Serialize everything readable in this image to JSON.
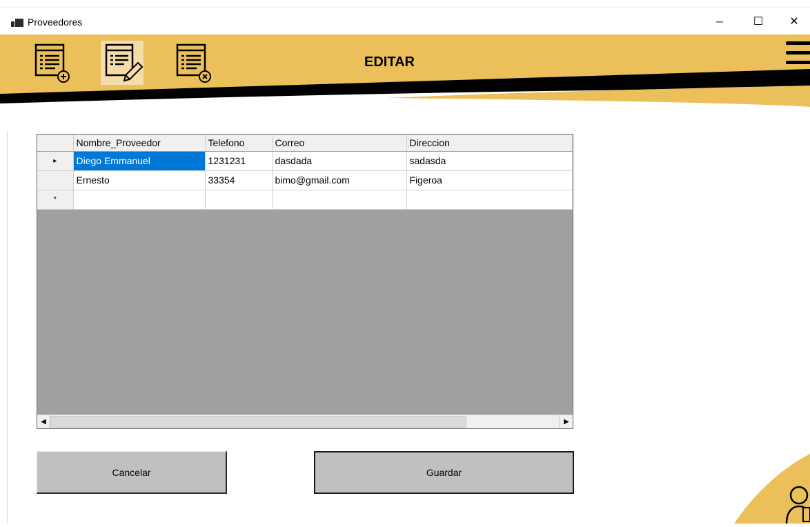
{
  "window": {
    "title": "Proveedores",
    "minimize_symbol": "─",
    "maximize_symbol": "☐",
    "close_symbol": "✕"
  },
  "header": {
    "title": "EDITAR",
    "accent_color": "#ebc05a",
    "band_color": "#000000",
    "tools": [
      {
        "name": "add-list-icon"
      },
      {
        "name": "edit-list-icon",
        "active": true
      },
      {
        "name": "delete-list-icon"
      }
    ],
    "menu_icon": "hamburger-menu-icon"
  },
  "grid": {
    "columns": [
      "Nombre_Proveedor",
      "Telefono",
      "Correo",
      "Direccion"
    ],
    "rows": [
      {
        "marker": "▸",
        "cells": [
          "Diego Emmanuel",
          "1231231",
          "dasdada",
          "sadasda"
        ],
        "selected_cell": 0
      },
      {
        "marker": "",
        "cells": [
          "Ernesto",
          "33354",
          "bimo@gmail.com",
          "Figeroa"
        ]
      },
      {
        "marker": "*",
        "cells": [
          "",
          "",
          "",
          ""
        ]
      }
    ],
    "scroll_left_symbol": "◀",
    "scroll_right_symbol": "▶"
  },
  "buttons": {
    "cancel_label": "Cancelar",
    "save_label": "Guardar"
  },
  "corner_icon": "user-edit-icon"
}
